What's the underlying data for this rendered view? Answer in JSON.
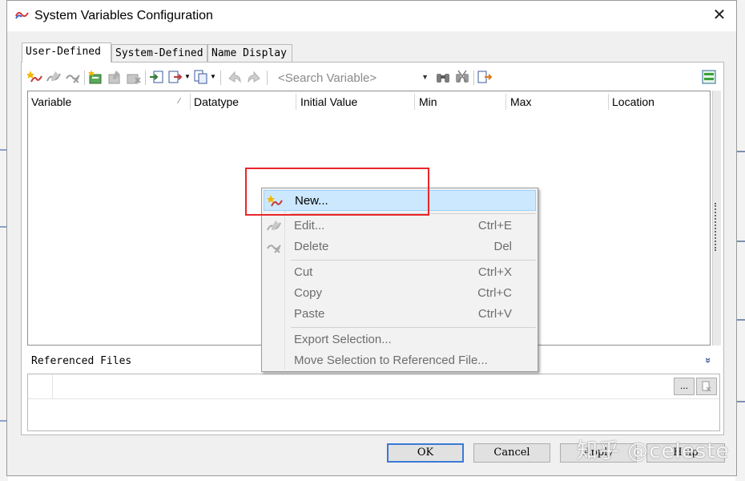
{
  "window": {
    "title": "System Variables Configuration",
    "close_glyph": "✕"
  },
  "tabs": [
    {
      "label": "User-Defined",
      "active": true
    },
    {
      "label": "System-Defined",
      "active": false
    },
    {
      "label": "Name Display",
      "active": false
    }
  ],
  "toolbar": {
    "icons": [
      "new-variable-icon",
      "edit-variable-icon",
      "delete-variable-icon",
      "new-struct-icon",
      "edit-struct-icon",
      "delete-struct-icon",
      "import-icon",
      "export-icon",
      "copy-icon",
      "undo-icon",
      "redo-icon",
      "find-icon",
      "find-next-icon",
      "reference-icon",
      "layout-icon"
    ],
    "search_placeholder": "<Search Variable>"
  },
  "grid": {
    "columns": [
      "Variable",
      "Datatype",
      "Initial Value",
      "Min",
      "Max",
      "Location"
    ],
    "sort_glyph": "⁄",
    "rows": []
  },
  "referenced_files": {
    "title": "Referenced Files",
    "browse_label": "...",
    "chevron": "»"
  },
  "buttons": {
    "ok": "OK",
    "cancel": "Cancel",
    "apply": "Apply",
    "help": "Help"
  },
  "context_menu": {
    "items": [
      {
        "label": "New...",
        "shortcut": "",
        "enabled": true,
        "highlighted": true,
        "icon": "new-variable-icon"
      },
      {
        "label": "Edit...",
        "shortcut": "Ctrl+E",
        "enabled": false,
        "icon": "edit-variable-icon"
      },
      {
        "label": "Delete",
        "shortcut": "Del",
        "enabled": false,
        "icon": "delete-variable-icon"
      },
      {
        "label": "Cut",
        "shortcut": "Ctrl+X",
        "enabled": false
      },
      {
        "label": "Copy",
        "shortcut": "Ctrl+C",
        "enabled": false
      },
      {
        "label": "Paste",
        "shortcut": "Ctrl+V",
        "enabled": false
      },
      {
        "label": "Export Selection...",
        "shortcut": "",
        "enabled": false
      },
      {
        "label": "Move Selection to Referenced File...",
        "shortcut": "",
        "enabled": false
      }
    ]
  },
  "watermark": "知乎 @celeste",
  "colors": {
    "highlight": "#cce8ff",
    "annotation_box": "#e8262b",
    "default_button_border": "#3b7ad3"
  }
}
